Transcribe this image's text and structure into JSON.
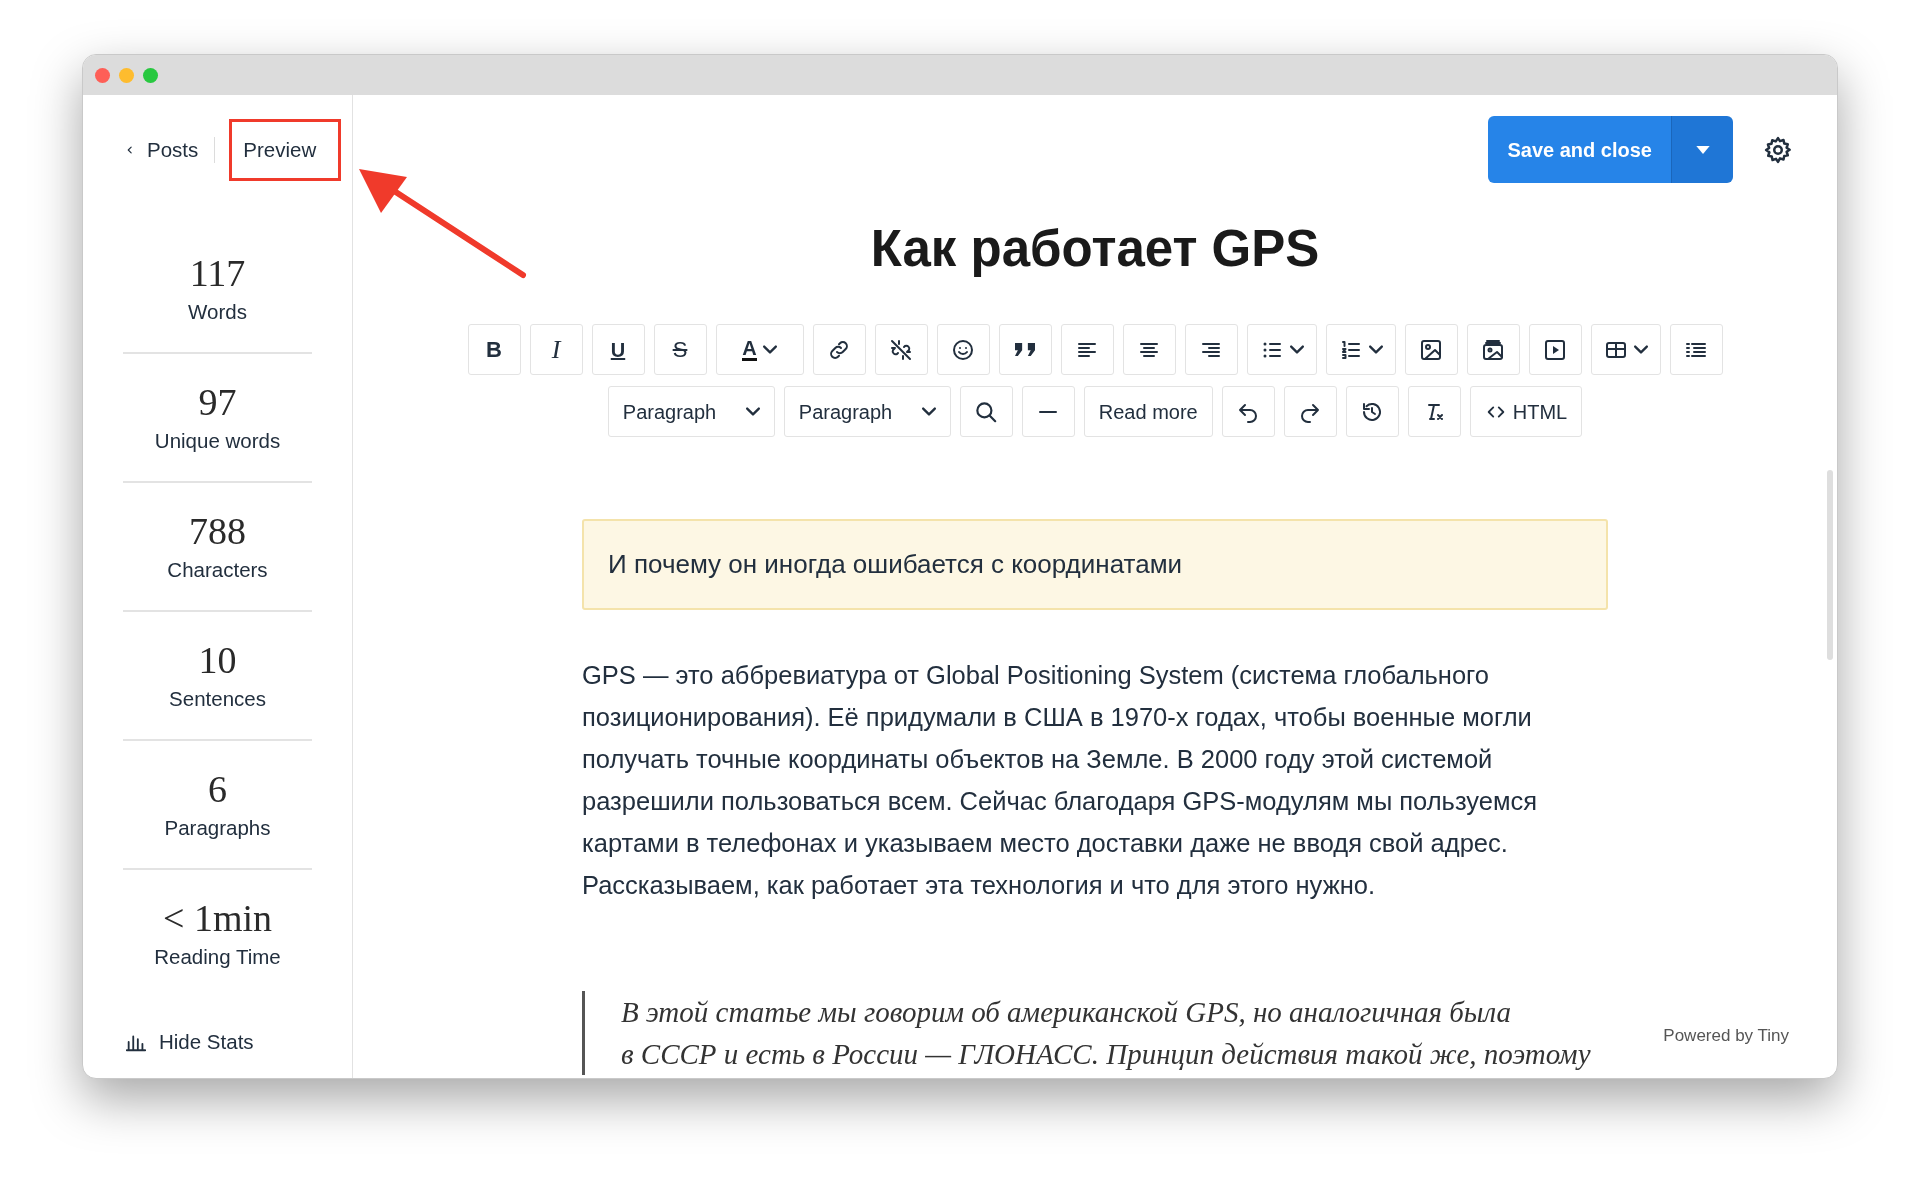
{
  "sidebar": {
    "back_link": "Posts",
    "preview_button": "Preview",
    "stats": [
      {
        "value": "117",
        "label": "Words"
      },
      {
        "value": "97",
        "label": "Unique words"
      },
      {
        "value": "788",
        "label": "Characters"
      },
      {
        "value": "10",
        "label": "Sentences"
      },
      {
        "value": "6",
        "label": "Paragraphs"
      },
      {
        "value": "< 1min",
        "label": "Reading Time"
      }
    ],
    "hide_stats": "Hide Stats"
  },
  "header": {
    "save_button": "Save and close"
  },
  "title": "Как работает GPS",
  "toolbar_row_1": [
    {
      "kind": "bold",
      "glyph": "B"
    },
    {
      "kind": "italic",
      "glyph": "I"
    },
    {
      "kind": "underline",
      "glyph": "U"
    },
    {
      "kind": "strike",
      "glyph": "S"
    },
    {
      "kind": "color",
      "glyph": "A"
    }
  ],
  "toolbar_row_2": {
    "block_format": "Paragraph",
    "paragraph_format": "Paragraph",
    "read_more": "Read more",
    "html": "HTML"
  },
  "callout": "И почему он иногда ошибается с координатами",
  "paragraph": "GPS — это аббревиатура от Global Positioning System (система глобального позиционирования). Её придумали в США в 1970-х годах, чтобы военные могли получать точные координаты объектов на Земле. В 2000 году этой системой разрешили пользоваться всем. Сейчас благодаря GPS-модулям мы пользуемся картами в телефонах и указываем место доставки даже не вводя свой адрес. Рассказываем, как работает эта технология и что для этого нужно.",
  "quote": [
    "В этой статье мы говорим об американской GPS, но аналогичная была",
    "в СССР и есть в России — ГЛОНАСС. Принцип действия такой же, поэтому"
  ],
  "footer": "Powered by Tiny"
}
